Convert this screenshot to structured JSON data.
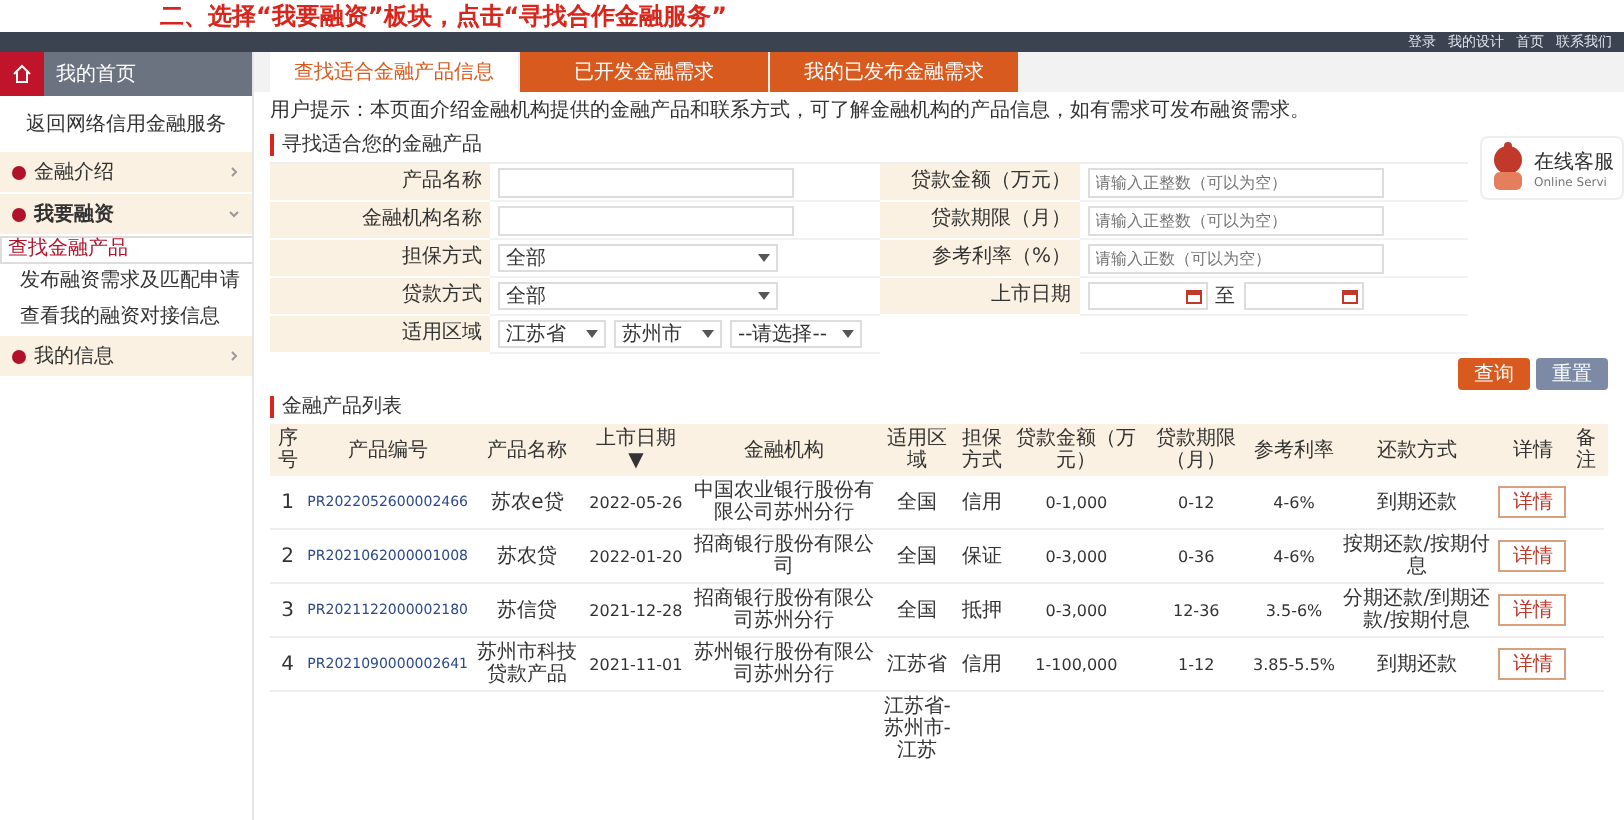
{
  "banner": "二、选择“我要融资”板块，点击“寻找合作金融服务”",
  "top_links": [
    "登录",
    "我的设计",
    "首页",
    "联系我们"
  ],
  "sidebar": {
    "home": "我的首页",
    "back": "返回网络信用金融服务",
    "sections": [
      {
        "label": "金融介绍",
        "expanded": false
      },
      {
        "label": "我要融资",
        "expanded": true,
        "children": [
          {
            "label": "查找金融产品",
            "selected": true
          },
          {
            "label": "发布融资需求及匹配申请",
            "selected": false
          },
          {
            "label": "查看我的融资对接信息",
            "selected": false
          }
        ]
      },
      {
        "label": "我的信息",
        "expanded": false
      }
    ]
  },
  "tabs": [
    {
      "label": "查找适合金融产品信息",
      "selected": true
    },
    {
      "label": "已开发金融需求",
      "selected": false
    },
    {
      "label": "我的已发布金融需求",
      "selected": false
    }
  ],
  "intro": "用户提示：本页面介绍金融机构提供的金融产品和联系方式，可了解金融机构的产品信息，如有需求可发布融资需求。",
  "search_title": "寻找适合您的金融产品",
  "chat": {
    "title": "在线客服",
    "subtitle": "Online Servi"
  },
  "form": {
    "left": [
      {
        "kind": "input",
        "label": "产品名称"
      },
      {
        "kind": "input",
        "label": "金融机构名称"
      },
      {
        "kind": "select",
        "label": "担保方式",
        "value": "全部"
      },
      {
        "kind": "select",
        "label": "贷款方式",
        "value": "全部"
      },
      {
        "kind": "region",
        "label": "适用区域",
        "values": [
          "江苏省",
          "苏州市",
          "--请选择--"
        ]
      }
    ],
    "right": [
      {
        "kind": "input",
        "label": "贷款金额（万元）",
        "placeholder": "请输入正整数（可以为空）"
      },
      {
        "kind": "input",
        "label": "贷款期限（月）",
        "placeholder": "请输入正整数（可以为空）"
      },
      {
        "kind": "input",
        "label": "参考利率（%）",
        "placeholder": "请输入正数（可以为空）"
      },
      {
        "kind": "daterange",
        "label": "上市日期",
        "separator": "至"
      }
    ]
  },
  "buttons": [
    {
      "label": "查询",
      "kind": "primary"
    },
    {
      "label": "重置",
      "kind": "secondary"
    }
  ],
  "list_title": "金融产品列表",
  "table": {
    "columns": [
      "序号",
      "产品编号",
      "产品名称",
      "上市日期 ▼",
      "金融机构",
      "适用区域",
      "担保方式",
      "贷款金额（万元）",
      "贷款期限（月）",
      "参考利率",
      "还款方式",
      "详情",
      "备注"
    ],
    "rows": [
      [
        "1",
        "PR2022052600002466",
        "苏农e贷",
        "2022-05-26",
        "中国农业银行股份有限公司苏州分行",
        "全国",
        "信用",
        "0-1,000",
        "0-12",
        "4-6%",
        "到期还款",
        "详情"
      ],
      [
        "2",
        "PR2021062000001008",
        "苏农贷",
        "2022-01-20",
        "招商银行股份有限公司",
        "全国",
        "保证",
        "0-3,000",
        "0-36",
        "4-6%",
        "按期还款/按期付息",
        "详情"
      ],
      [
        "3",
        "PR2021122000002180",
        "苏信贷",
        "2021-12-28",
        "招商银行股份有限公司苏州分行",
        "全国",
        "抵押",
        "0-3,000",
        "12-36",
        "3.5-6%",
        "分期还款/到期还款/按期付息",
        "详情"
      ],
      [
        "4",
        "PR2021090000002641",
        "苏州市科技贷款产品",
        "2021-11-01",
        "苏州银行股份有限公司苏州分行",
        "江苏省",
        "信用",
        "1-100,000",
        "1-12",
        "3.85-5.5%",
        "到期还款",
        "详情"
      ]
    ],
    "overflow": "江苏省-苏州市-江苏"
  }
}
